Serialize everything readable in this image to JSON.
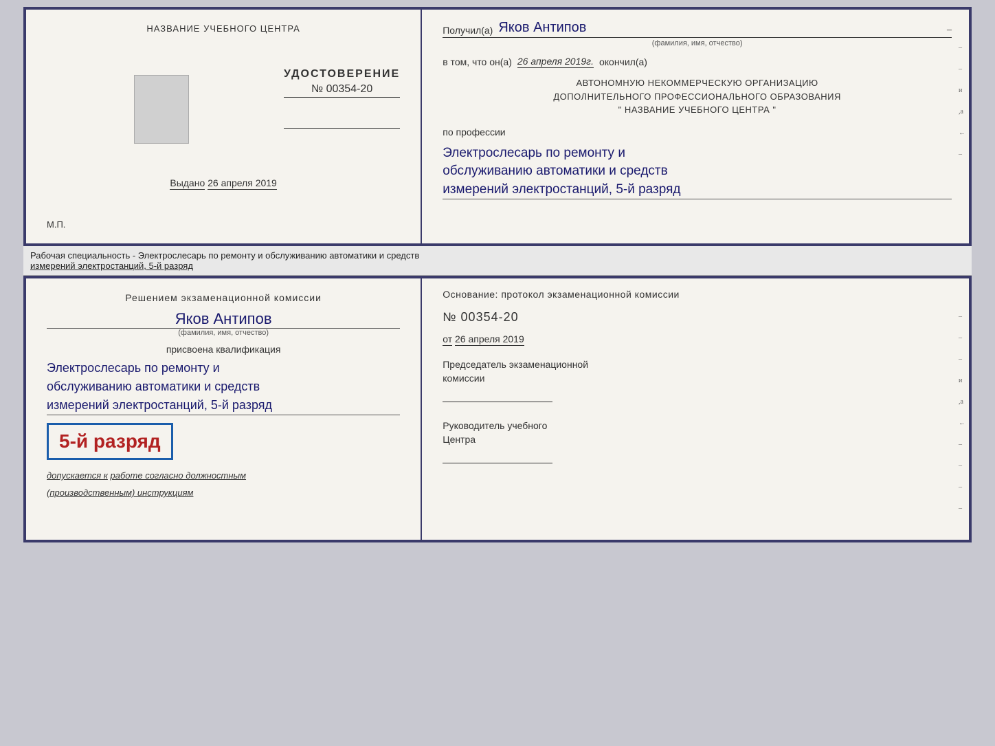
{
  "top_left": {
    "school_name": "НАЗВАНИЕ УЧЕБНОГО ЦЕНТРА",
    "cert_title": "УДОСТОВЕРЕНИЕ",
    "cert_number": "№ 00354-20",
    "issued_label": "Выдано",
    "issued_date": "26 апреля 2019",
    "mp_label": "М.П."
  },
  "top_right": {
    "recipient_label": "Получил(а)",
    "recipient_name": "Яков Антипов",
    "recipient_dash": "–",
    "recipient_subtitle": "(фамилия, имя, отчество)",
    "cert_intro": "в том, что он(а)",
    "cert_date": "26 апреля 2019г.",
    "cert_finished": "окончил(а)",
    "org_line1": "АВТОНОМНУЮ НЕКОММЕРЧЕСКУЮ ОРГАНИЗАЦИЮ",
    "org_line2": "ДОПОЛНИТЕЛЬНОГО ПРОФЕССИОНАЛЬНОГО ОБРАЗОВАНИЯ",
    "org_line3": "\"  НАЗВАНИЕ УЧЕБНОГО ЦЕНТРА  \"",
    "profession_label": "по профессии",
    "profession_line1": "Электрослесарь по ремонту и",
    "profession_line2": "обслуживанию автоматики и средств",
    "profession_line3": "измерений электростанций, 5-й разряд"
  },
  "middle": {
    "text": "Рабочая специальность - Электрослесарь по ремонту и обслуживанию автоматики и средств",
    "text2": "измерений электростанций, 5-й разряд"
  },
  "bottom_left": {
    "decision_text": "Решением экзаменационной комиссии",
    "person_name": "Яков Антипов",
    "person_subtitle": "(фамилия, имя, отчество)",
    "qualification_label": "присвоена квалификация",
    "qual_line1": "Электрослесарь по ремонту и",
    "qual_line2": "обслуживанию автоматики и средств",
    "qual_line3": "измерений электростанций, 5-й разряд",
    "grade_label": "5-й разряд",
    "допускается_text": "допускается к",
    "допускается_link": "работе согласно должностным",
    "инструкциям": "(производственным) инструкциям"
  },
  "bottom_right": {
    "basis_text": "Основание: протокол экзаменационной  комиссии",
    "protocol_number": "№  00354-20",
    "protocol_from": "от",
    "protocol_date": "26 апреля 2019",
    "chairman_label": "Председатель экзаменационной",
    "chairman_label2": "комиссии",
    "director_label": "Руководитель учебного",
    "director_label2": "Центра"
  },
  "side_marks": {
    "и": "и",
    "а": ",а",
    "left": "←"
  }
}
